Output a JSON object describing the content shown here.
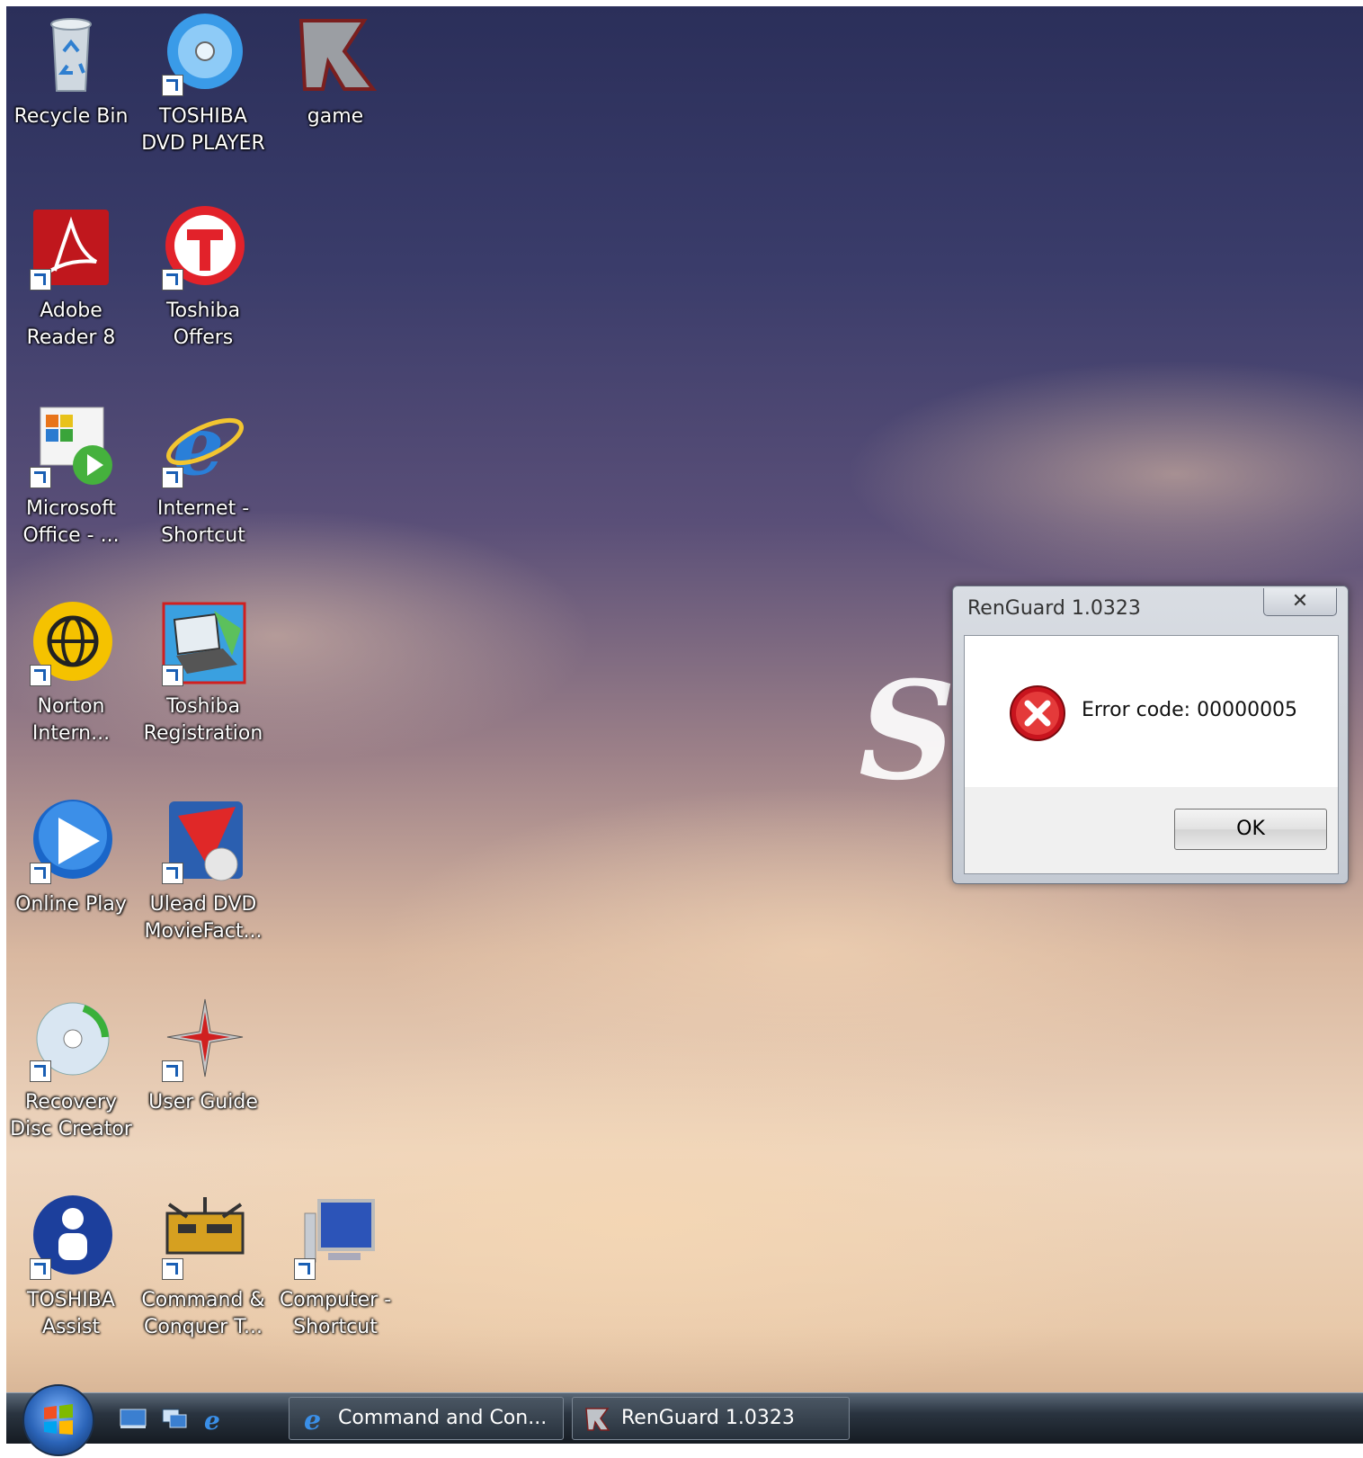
{
  "desktop": {
    "watermark": "S",
    "icons": [
      {
        "label": "Recycle Bin",
        "icon": "recycle-bin-icon"
      },
      {
        "label": "TOSHIBA DVD PLAYER",
        "icon": "dvd-player-icon"
      },
      {
        "label": "game",
        "icon": "game-icon"
      },
      {
        "label": "Adobe Reader 8",
        "icon": "adobe-reader-icon"
      },
      {
        "label": "Toshiba Offers",
        "icon": "toshiba-offers-icon"
      },
      {
        "label": "Microsoft Office - ...",
        "icon": "ms-office-icon"
      },
      {
        "label": "Internet - Shortcut",
        "icon": "internet-explorer-icon"
      },
      {
        "label": "Norton Intern...",
        "icon": "norton-icon"
      },
      {
        "label": "Toshiba Registration",
        "icon": "laptop-icon"
      },
      {
        "label": "Online Play",
        "icon": "online-play-icon"
      },
      {
        "label": "Ulead DVD MovieFact...",
        "icon": "ulead-dvd-icon"
      },
      {
        "label": "Recovery Disc Creator",
        "icon": "recovery-disc-icon"
      },
      {
        "label": "User Guide",
        "icon": "user-guide-icon"
      },
      {
        "label": "TOSHIBA Assist",
        "icon": "toshiba-assist-icon"
      },
      {
        "label": "Command & Conquer T...",
        "icon": "command-conquer-icon"
      },
      {
        "label": "Computer - Shortcut",
        "icon": "computer-icon"
      }
    ]
  },
  "dialog": {
    "title": "RenGuard 1.0323",
    "close_label": "✕",
    "message": "Error code: 00000005",
    "ok_label": "OK",
    "icon": "error-icon"
  },
  "taskbar": {
    "tasks": [
      {
        "label": "Command and Con...",
        "icon": "internet-explorer-icon"
      },
      {
        "label": "RenGuard 1.0323",
        "icon": "renguard-icon"
      }
    ],
    "quick_launch": [
      "show-desktop-icon",
      "switch-windows-icon",
      "internet-explorer-icon"
    ]
  },
  "colors": {
    "error_red": "#c8141e",
    "taskbar": "#1f2832",
    "dialog_frame": "#c9ced6"
  }
}
